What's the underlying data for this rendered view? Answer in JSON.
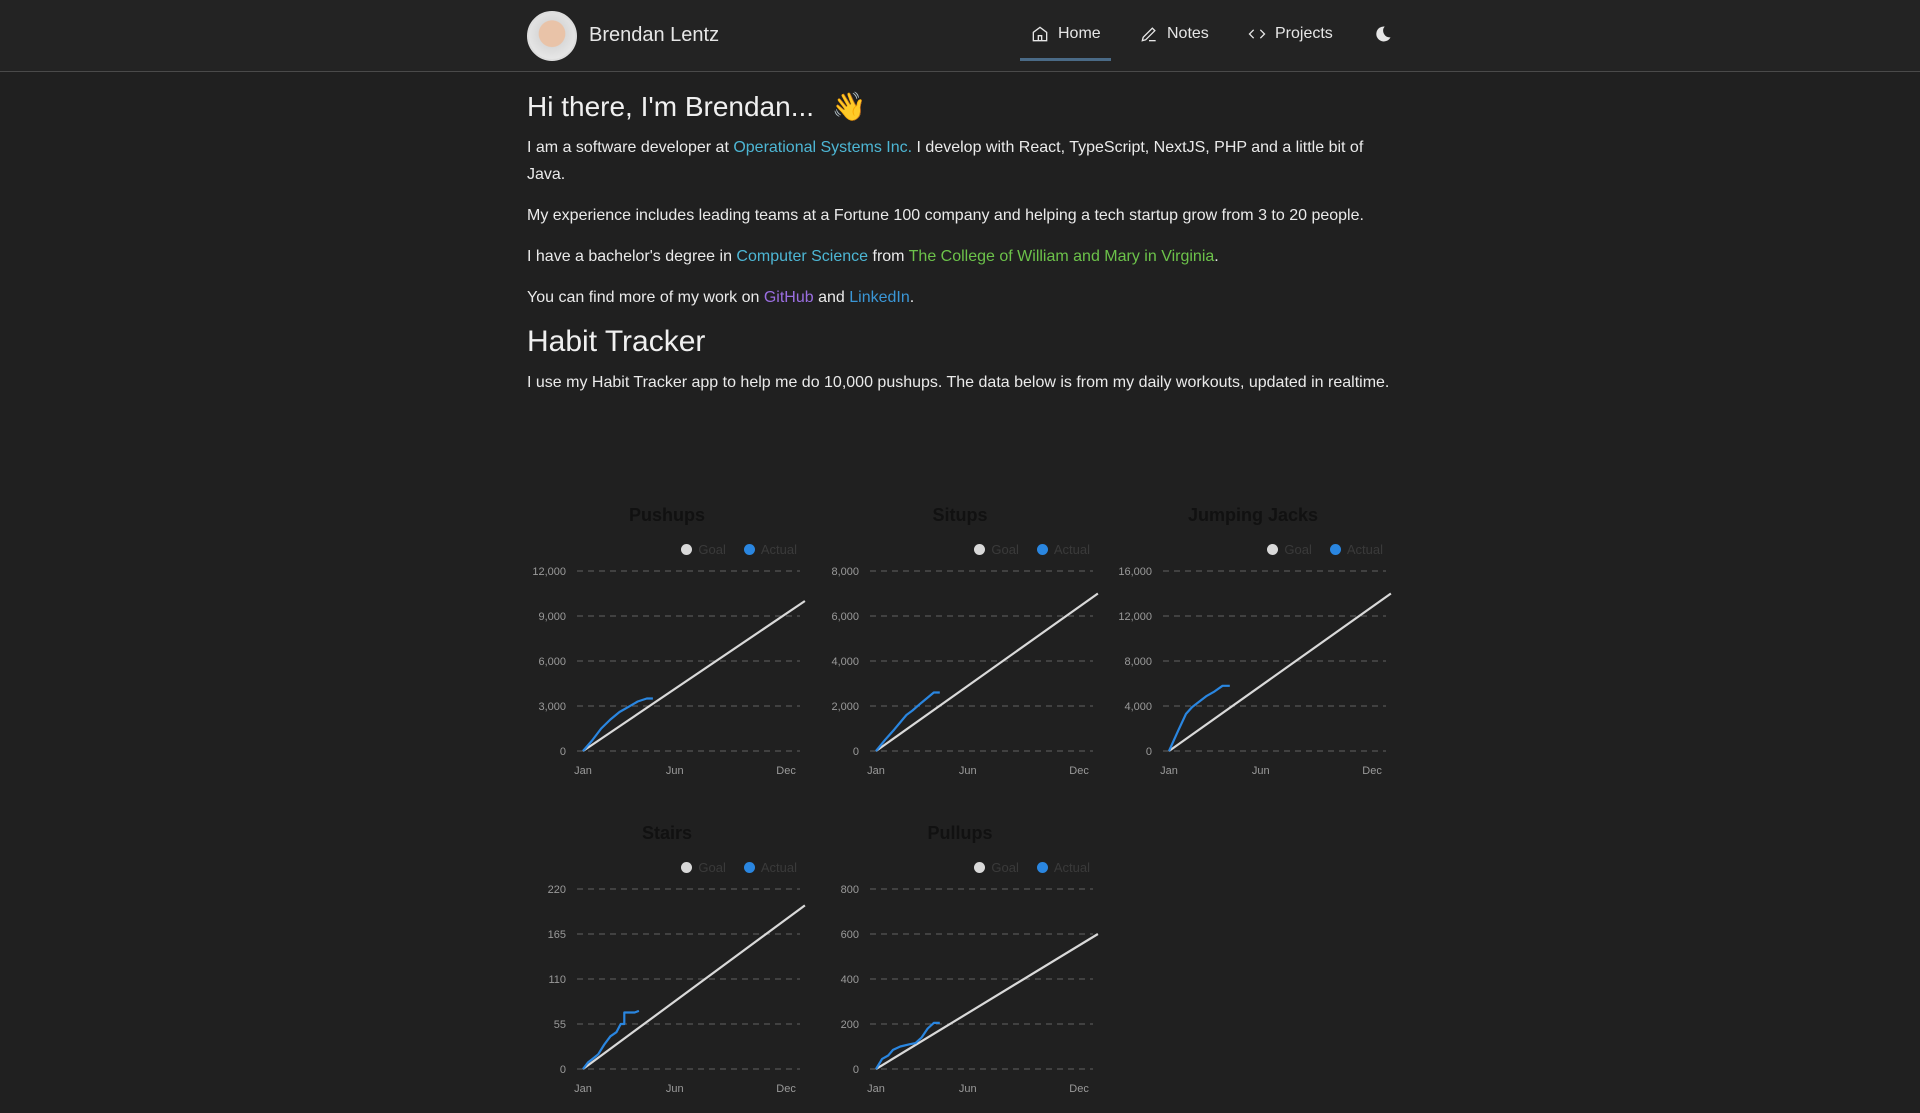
{
  "header": {
    "name": "Brendan Lentz",
    "nav": [
      {
        "label": "Home",
        "icon": "home-icon",
        "active": true
      },
      {
        "label": "Notes",
        "icon": "pencil-icon"
      },
      {
        "label": "Projects",
        "icon": "code-icon"
      }
    ],
    "theme_icon": "moon-icon"
  },
  "intro": {
    "title": "Hi there, I'm Brendan...",
    "emoji": "👋",
    "p1": {
      "a": "I am a software developer at ",
      "link": "Operational Systems Inc.",
      "b": " I develop with React, TypeScript, NextJS, PHP and a little bit of Java."
    },
    "p2": "My experience includes leading teams at a Fortune 100 company and helping a tech startup grow from 3 to 20 people.",
    "p3": {
      "a": "I have a bachelor's degree in ",
      "link1": "Computer Science",
      "b": " from ",
      "link2": "The College of William and Mary in Virginia",
      "c": "."
    },
    "p4": {
      "a": "You can find more of my work on ",
      "link1": "GitHub",
      "b": " and ",
      "link2": "LinkedIn",
      "c": "."
    }
  },
  "habit": {
    "title": "Habit Tracker",
    "desc": "I use my Habit Tracker app to help me do 10,000 pushups. The data below is from my daily workouts, updated in realtime."
  },
  "colors": {
    "goal": "#d9d9d9",
    "actual": "#2a86e0",
    "link_cyan": "#4db6d4",
    "link_green": "#6cc24a",
    "link_purple": "#9a6ee0",
    "link_blue": "#3a96d6"
  },
  "chart_data": [
    {
      "type": "line",
      "title": "Pushups",
      "legend": [
        "Goal",
        "Actual"
      ],
      "yticks": [
        0,
        3000,
        6000,
        9000,
        12000
      ],
      "ytick_labels": [
        "0",
        "3,000",
        "6,000",
        "9,000",
        "12,000"
      ],
      "xticks": [
        "Jan",
        "Jun",
        "Dec"
      ],
      "ylim": [
        0,
        12000
      ],
      "goal": [
        [
          0,
          0
        ],
        [
          365,
          10000
        ]
      ],
      "actual": [
        [
          0,
          0
        ],
        [
          15,
          700
        ],
        [
          30,
          1500
        ],
        [
          45,
          2100
        ],
        [
          60,
          2600
        ],
        [
          75,
          2950
        ],
        [
          90,
          3300
        ],
        [
          105,
          3500
        ],
        [
          115,
          3500
        ]
      ]
    },
    {
      "type": "line",
      "title": "Situps",
      "legend": [
        "Goal",
        "Actual"
      ],
      "yticks": [
        0,
        2000,
        4000,
        6000,
        8000
      ],
      "ytick_labels": [
        "0",
        "2,000",
        "4,000",
        "6,000",
        "8,000"
      ],
      "xticks": [
        "Jan",
        "Jun",
        "Dec"
      ],
      "ylim": [
        0,
        8000
      ],
      "goal": [
        [
          0,
          0
        ],
        [
          365,
          7000
        ]
      ],
      "actual": [
        [
          0,
          0
        ],
        [
          15,
          500
        ],
        [
          30,
          950
        ],
        [
          50,
          1600
        ],
        [
          60,
          1800
        ],
        [
          75,
          2150
        ],
        [
          95,
          2600
        ],
        [
          105,
          2600
        ]
      ]
    },
    {
      "type": "line",
      "title": "Jumping Jacks",
      "legend": [
        "Goal",
        "Actual"
      ],
      "yticks": [
        0,
        4000,
        8000,
        12000,
        16000
      ],
      "ytick_labels": [
        "0",
        "4,000",
        "8,000",
        "12,000",
        "16,000"
      ],
      "xticks": [
        "Jan",
        "Jun",
        "Dec"
      ],
      "ylim": [
        0,
        16000
      ],
      "goal": [
        [
          0,
          0
        ],
        [
          365,
          14000
        ]
      ],
      "actual": [
        [
          0,
          0
        ],
        [
          15,
          1800
        ],
        [
          28,
          3300
        ],
        [
          38,
          3900
        ],
        [
          50,
          4400
        ],
        [
          62,
          4900
        ],
        [
          75,
          5300
        ],
        [
          88,
          5800
        ],
        [
          100,
          5800
        ]
      ]
    },
    {
      "type": "line",
      "title": "Stairs",
      "legend": [
        "Goal",
        "Actual"
      ],
      "yticks": [
        0,
        55,
        110,
        165,
        220
      ],
      "ytick_labels": [
        "0",
        "55",
        "110",
        "165",
        "220"
      ],
      "xticks": [
        "Jan",
        "Jun",
        "Dec"
      ],
      "ylim": [
        0,
        220
      ],
      "goal": [
        [
          0,
          0
        ],
        [
          365,
          200
        ]
      ],
      "actual": [
        [
          0,
          0
        ],
        [
          8,
          8
        ],
        [
          15,
          12
        ],
        [
          25,
          18
        ],
        [
          35,
          30
        ],
        [
          45,
          40
        ],
        [
          55,
          45
        ],
        [
          62,
          55
        ],
        [
          68,
          55
        ],
        [
          68,
          69
        ],
        [
          85,
          69
        ],
        [
          92,
          71
        ]
      ]
    },
    {
      "type": "line",
      "title": "Pullups",
      "legend": [
        "Goal",
        "Actual"
      ],
      "yticks": [
        0,
        200,
        400,
        600,
        800
      ],
      "ytick_labels": [
        "0",
        "200",
        "400",
        "600",
        "800"
      ],
      "xticks": [
        "Jan",
        "Jun",
        "Dec"
      ],
      "ylim": [
        0,
        800
      ],
      "goal": [
        [
          0,
          0
        ],
        [
          365,
          600
        ]
      ],
      "actual": [
        [
          0,
          0
        ],
        [
          10,
          45
        ],
        [
          20,
          60
        ],
        [
          28,
          85
        ],
        [
          40,
          100
        ],
        [
          55,
          110
        ],
        [
          65,
          115
        ],
        [
          75,
          140
        ],
        [
          85,
          180
        ],
        [
          95,
          205
        ],
        [
          105,
          205
        ]
      ]
    }
  ]
}
